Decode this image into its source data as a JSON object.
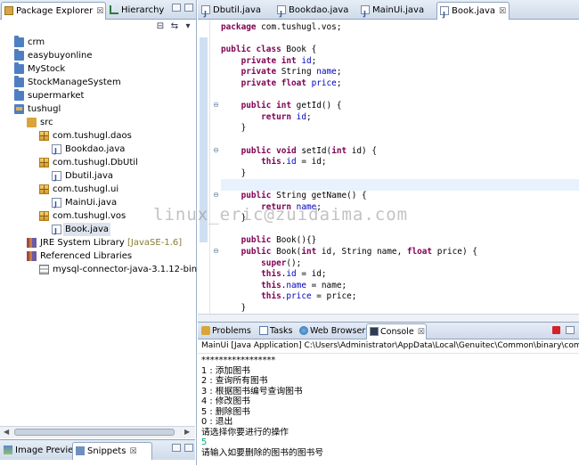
{
  "left_panel": {
    "tabs": [
      {
        "label": "Package Explorer",
        "close": "☒"
      },
      {
        "label": "Hierarchy",
        "close": ""
      }
    ],
    "tree": [
      {
        "label": "crm",
        "icon": "project-folder-icon",
        "indent": 0
      },
      {
        "label": "easybuyonline",
        "icon": "project-folder-icon",
        "indent": 0
      },
      {
        "label": "MyStock",
        "icon": "project-folder-icon",
        "indent": 0
      },
      {
        "label": "StockManageSystem",
        "icon": "project-folder-icon",
        "indent": 0
      },
      {
        "label": "supermarket",
        "icon": "project-folder-icon",
        "indent": 0
      },
      {
        "label": "tushugl",
        "icon": "open-project-icon",
        "indent": 0
      },
      {
        "label": "src",
        "icon": "source-folder-icon",
        "indent": 1
      },
      {
        "label": "com.tushugl.daos",
        "icon": "package-icon",
        "indent": 2
      },
      {
        "label": "Bookdao.java",
        "icon": "java-file-icon",
        "indent": 3
      },
      {
        "label": "com.tushugl.DbUtil",
        "icon": "package-icon",
        "indent": 2
      },
      {
        "label": "Dbutil.java",
        "icon": "java-file-icon",
        "indent": 3
      },
      {
        "label": "com.tushugl.ui",
        "icon": "package-icon",
        "indent": 2
      },
      {
        "label": "MainUi.java",
        "icon": "java-file-icon",
        "indent": 3
      },
      {
        "label": "com.tushugl.vos",
        "icon": "package-icon",
        "indent": 2
      },
      {
        "label": "Book.java",
        "icon": "java-file-icon",
        "indent": 3,
        "selected": true
      },
      {
        "label": "JRE System Library",
        "decor": "[JavaSE-1.6]",
        "icon": "library-icon",
        "indent": 1
      },
      {
        "label": "Referenced Libraries",
        "icon": "library-icon",
        "indent": 1
      },
      {
        "label": "mysql-connector-java-3.1.12-bin.jar - ",
        "icon": "jar-icon",
        "indent": 2
      }
    ],
    "bottom_tabs": [
      {
        "label": "Image Preview"
      },
      {
        "label": "Snippets",
        "close": "☒"
      }
    ]
  },
  "editor": {
    "tabs": [
      {
        "label": "Dbutil.java"
      },
      {
        "label": "Bookdao.java"
      },
      {
        "label": "MainUi.java"
      },
      {
        "label": "Book.java",
        "close": "☒",
        "active": true
      }
    ],
    "lines": [
      [
        [
          "package ",
          "kw"
        ],
        [
          "com.tushugl.vos;",
          ""
        ]
      ],
      [],
      [
        [
          "public class ",
          "kw"
        ],
        [
          "Book {",
          ""
        ]
      ],
      [
        [
          "    private int ",
          "kw"
        ],
        [
          "id",
          "fld"
        ],
        [
          ";",
          ""
        ]
      ],
      [
        [
          "    private ",
          "kw"
        ],
        [
          "String ",
          ""
        ],
        [
          "name",
          "fld"
        ],
        [
          ";",
          ""
        ]
      ],
      [
        [
          "    private float ",
          "kw"
        ],
        [
          "price",
          "fld"
        ],
        [
          ";",
          ""
        ]
      ],
      [],
      [
        [
          "    public int ",
          "kw"
        ],
        [
          "getId() {",
          ""
        ]
      ],
      [
        [
          "        return ",
          "kw"
        ],
        [
          "id",
          "fld"
        ],
        [
          ";",
          ""
        ]
      ],
      [
        [
          "    }",
          ""
        ]
      ],
      [],
      [
        [
          "    public void ",
          "kw"
        ],
        [
          "setId(",
          ""
        ],
        [
          "int ",
          "kw"
        ],
        [
          "id) {",
          ""
        ]
      ],
      [
        [
          "        this",
          "kw"
        ],
        [
          ".",
          ""
        ],
        [
          "id",
          "fld"
        ],
        [
          " = id;",
          ""
        ]
      ],
      [
        [
          "    }",
          ""
        ]
      ],
      [],
      [
        [
          "    public ",
          "kw"
        ],
        [
          "String getName() {",
          ""
        ]
      ],
      [
        [
          "        return ",
          "kw"
        ],
        [
          "name",
          "fld"
        ],
        [
          ";",
          ""
        ]
      ],
      [
        [
          "    }",
          ""
        ]
      ],
      [],
      [
        [
          "    public ",
          "kw"
        ],
        [
          "Book(){}",
          ""
        ]
      ],
      [
        [
          "    public ",
          "kw"
        ],
        [
          "Book(",
          ""
        ],
        [
          "int ",
          "kw"
        ],
        [
          "id, String name, ",
          ""
        ],
        [
          "float ",
          "kw"
        ],
        [
          "price) {",
          ""
        ]
      ],
      [
        [
          "        super",
          "kw"
        ],
        [
          "();",
          ""
        ]
      ],
      [
        [
          "        this",
          "kw"
        ],
        [
          ".",
          ""
        ],
        [
          "id",
          "fld"
        ],
        [
          " = id;",
          ""
        ]
      ],
      [
        [
          "        this",
          "kw"
        ],
        [
          ".",
          ""
        ],
        [
          "name",
          "fld"
        ],
        [
          " = name;",
          ""
        ]
      ],
      [
        [
          "        this",
          "kw"
        ],
        [
          ".",
          ""
        ],
        [
          "price",
          "fld"
        ],
        [
          " = price;",
          ""
        ]
      ],
      [
        [
          "    }",
          ""
        ]
      ]
    ],
    "fold_markers": [
      7,
      11,
      15,
      20
    ],
    "current_line": 14,
    "watermark": "linux_eric@zuidaima.com"
  },
  "console": {
    "tabs": [
      {
        "label": "Problems",
        "icon": "problems-icon"
      },
      {
        "label": "Tasks",
        "icon": "tasks-icon"
      },
      {
        "label": "Web Browser",
        "icon": "web-browser-icon"
      },
      {
        "label": "Console",
        "icon": "console-icon",
        "close": "☒",
        "active": true
      }
    ],
    "header": "MainUi [Java Application] C:\\Users\\Administrator\\AppData\\Local\\Genuitec\\Common\\binary\\com.su",
    "lines": [
      {
        "text": "*****************",
        "type": "out"
      },
      {
        "text": "1 : 添加图书",
        "type": "out"
      },
      {
        "text": "2 : 查询所有图书",
        "type": "out"
      },
      {
        "text": "3 : 根据图书编号查询图书",
        "type": "out"
      },
      {
        "text": "4 : 修改图书",
        "type": "out"
      },
      {
        "text": "5 : 删除图书",
        "type": "out"
      },
      {
        "text": "0 : 退出",
        "type": "out"
      },
      {
        "text": "请选择你要进行的操作",
        "type": "out"
      },
      {
        "text": "5",
        "type": "in"
      },
      {
        "text": "请输入如要删除的图书的图书号",
        "type": "out"
      }
    ]
  }
}
